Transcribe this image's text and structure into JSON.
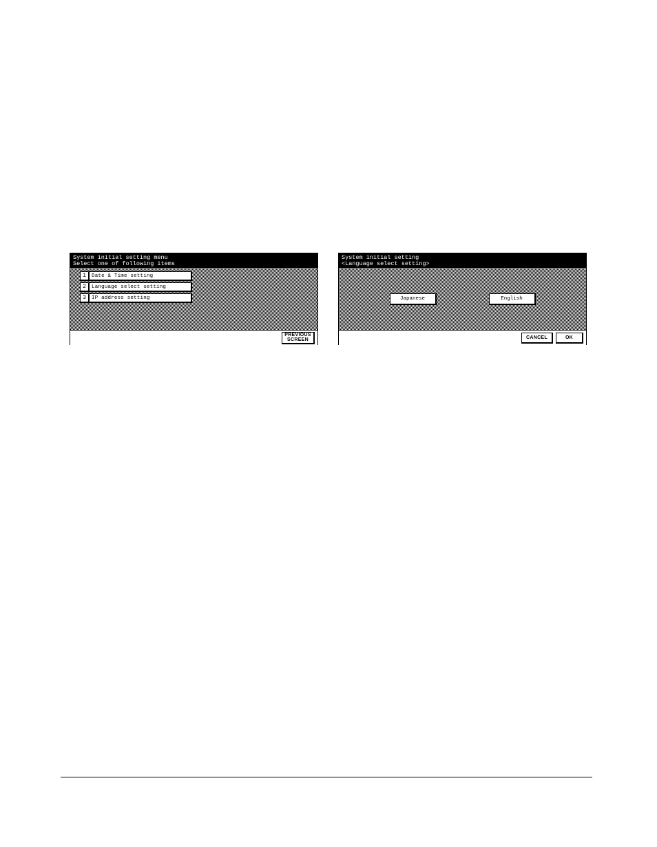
{
  "left_panel": {
    "title_line1": "System initial setting menu",
    "title_line2": "Select one of following items",
    "items": [
      {
        "number": "1",
        "label": "Date & Time setting"
      },
      {
        "number": "2",
        "label": "Language select setting"
      },
      {
        "number": "3",
        "label": "IP address setting"
      }
    ],
    "footer": {
      "previous_label": "PREVIOUS\nSCREEN"
    }
  },
  "right_panel": {
    "title_line1": "System initial setting",
    "title_line2": "<Language select setting>",
    "options": {
      "japanese_label": "Japanese",
      "english_label": "English"
    },
    "footer": {
      "cancel_label": "CANCEL",
      "ok_label": "OK"
    }
  }
}
